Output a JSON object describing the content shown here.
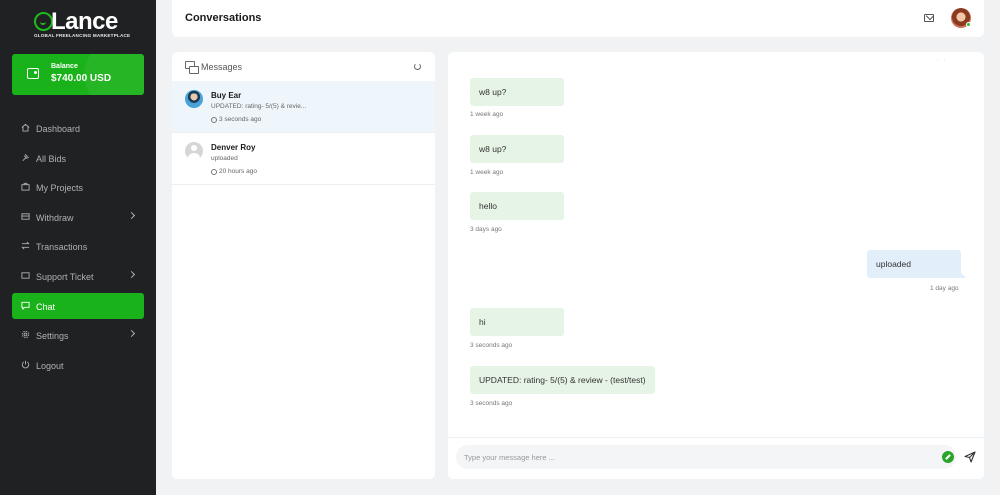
{
  "brand": {
    "name": "Lance",
    "tagline": "GLOBAL FREELANCING MARKETPLACE",
    "accent": "#1ab21a"
  },
  "balance": {
    "label": "Balance",
    "value": "$740.00 USD"
  },
  "sidebar": {
    "items": [
      {
        "label": "Dashboard",
        "icon": "home-icon"
      },
      {
        "label": "All Bids",
        "icon": "gavel-icon"
      },
      {
        "label": "My Projects",
        "icon": "briefcase-icon"
      },
      {
        "label": "Withdraw",
        "icon": "withdraw-icon",
        "has_submenu": true
      },
      {
        "label": "Transactions",
        "icon": "transfer-icon"
      },
      {
        "label": "Support Ticket",
        "icon": "ticket-icon",
        "has_submenu": true
      },
      {
        "label": "Chat",
        "icon": "chat-icon",
        "active": true
      },
      {
        "label": "Settings",
        "icon": "gear-icon",
        "has_submenu": true
      },
      {
        "label": "Logout",
        "icon": "logout-icon"
      }
    ]
  },
  "header": {
    "title": "Conversations"
  },
  "messages_panel": {
    "title": "Messages",
    "conversations": [
      {
        "name": "Buy Ear",
        "preview": "UPDATED: rating- 5/(5) & revie...",
        "time": "3 seconds ago",
        "active": true
      },
      {
        "name": "Denver Roy",
        "preview": "uploaded",
        "time": "20 hours ago",
        "active": false
      }
    ]
  },
  "chat": {
    "messages": [
      {
        "text": "w8 up?",
        "time": "1 week ago",
        "direction": "received"
      },
      {
        "text": "w8 up?",
        "time": "1 week ago",
        "direction": "received"
      },
      {
        "text": "hello",
        "time": "3 days ago",
        "direction": "received"
      },
      {
        "text": "uploaded",
        "time": "1 day ago",
        "direction": "sent"
      },
      {
        "text": "hi",
        "time": "3 seconds ago",
        "direction": "received"
      },
      {
        "text": "UPDATED: rating- 5/(5) & review - (test/test)",
        "time": "3 seconds ago",
        "direction": "received"
      }
    ],
    "input_placeholder": "Type your message here ..."
  }
}
